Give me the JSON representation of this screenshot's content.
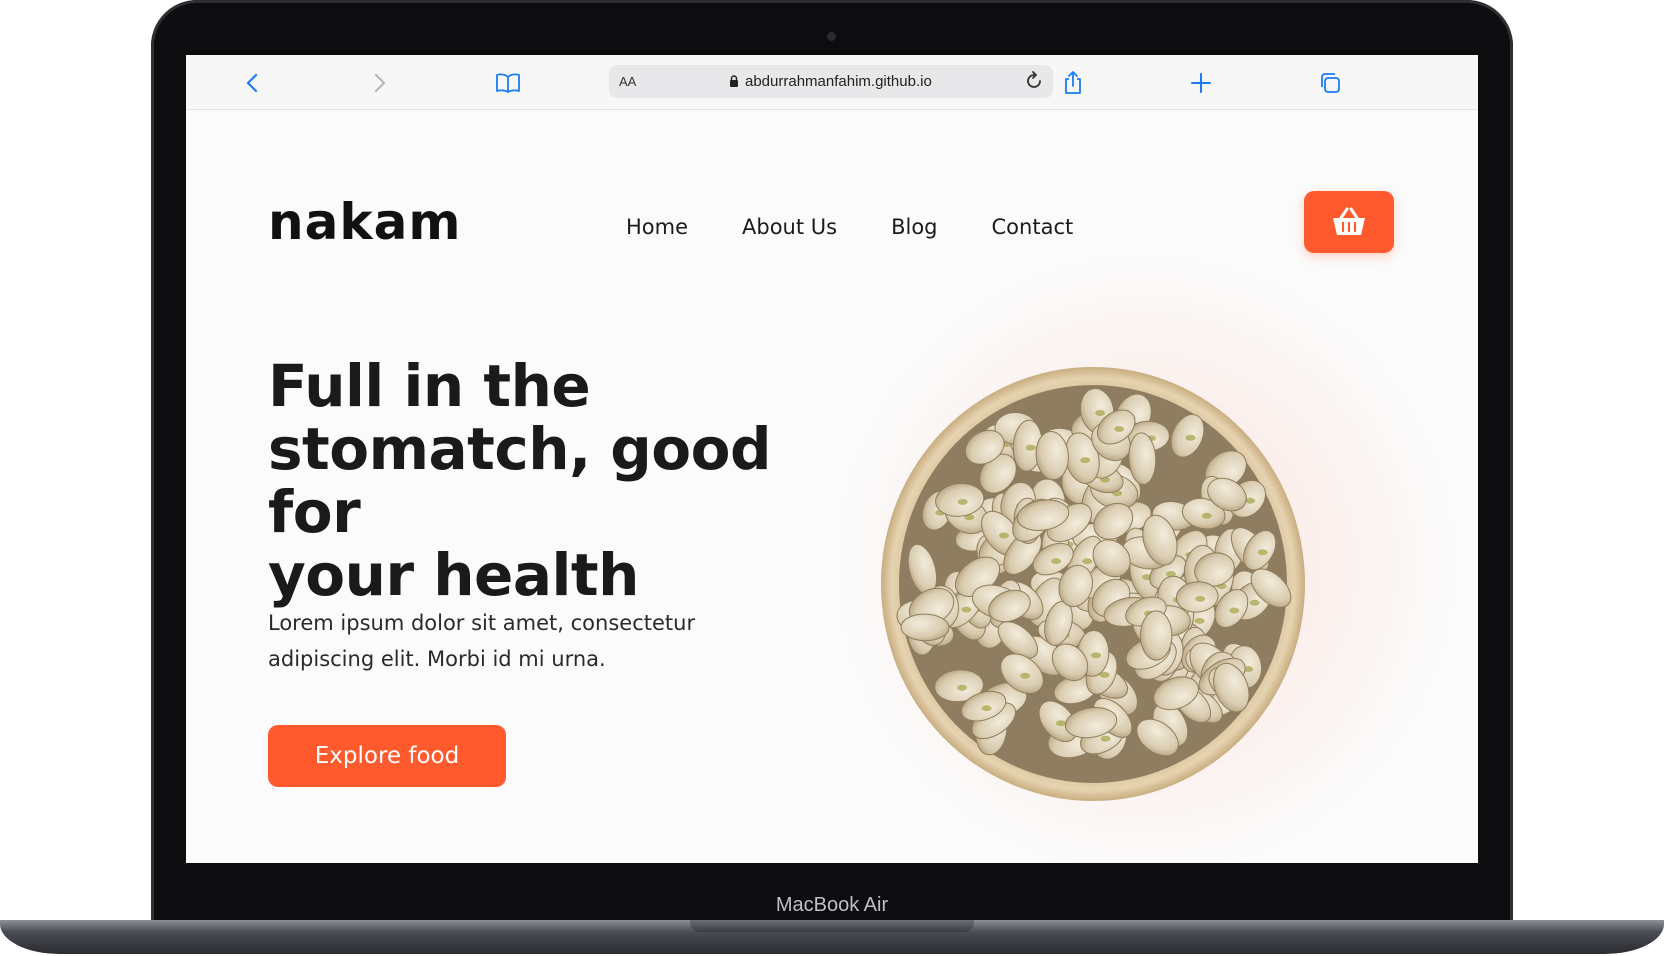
{
  "device": {
    "label": "MacBook Air"
  },
  "browser": {
    "text_size_label": "AA",
    "url": "abdurrahmanfahim.github.io",
    "icons": {
      "back": "chevron-left-icon",
      "forward": "chevron-right-icon",
      "bookmarks": "book-icon",
      "lock": "lock-icon",
      "reload": "reload-icon",
      "share": "share-icon",
      "new_tab": "plus-icon",
      "tabs": "tabs-icon"
    },
    "accent_color": "#1a7cf5"
  },
  "site": {
    "logo": "nakam",
    "nav": [
      "Home",
      "About Us",
      "Blog",
      "Contact"
    ],
    "cart_icon": "basket-icon",
    "hero": {
      "title_lines": [
        "Full in the",
        "stomatch, good for",
        "your health"
      ],
      "description_lines": [
        "Lorem ipsum dolor sit amet, consectetur",
        "adipiscing elit. Morbi id mi urna."
      ],
      "cta_label": "Explore food",
      "image": "pistachio-bowl"
    },
    "brand_color": "#ff5a2e"
  }
}
